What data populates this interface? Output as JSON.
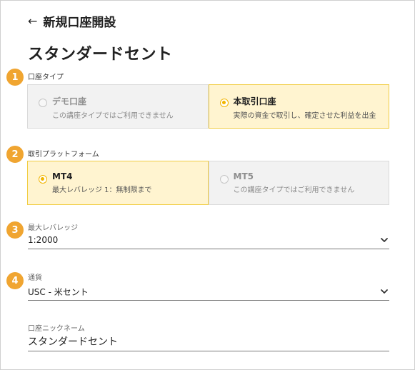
{
  "header": {
    "back_icon": "arrow-left-icon",
    "back_title": "新規口座開設"
  },
  "page_title": "スタンダードセント",
  "steps": [
    "1",
    "2",
    "3",
    "4"
  ],
  "account_type": {
    "label": "口座タイプ",
    "options": [
      {
        "title": "デモ口座",
        "description": "この講座タイプではご利用できません",
        "selected": false
      },
      {
        "title": "本取引口座",
        "description": "実際の資金で取引し、確定させた利益を出金",
        "selected": true
      }
    ]
  },
  "platform": {
    "label": "取引プラットフォーム",
    "options": [
      {
        "title": "MT4",
        "description": "最大レバレッジ 1：無制限まで",
        "selected": true
      },
      {
        "title": "MT5",
        "description": "この講座タイプではご利用できません",
        "selected": false
      }
    ]
  },
  "leverage": {
    "label": "最大レバレッジ",
    "value": "1:2000",
    "icon": "chevron-down-icon"
  },
  "currency": {
    "label": "通貨",
    "value": "USC - 米セント",
    "icon": "chevron-down-icon"
  },
  "nickname": {
    "label": "口座ニックネーム",
    "value": "スタンダードセント"
  },
  "colors": {
    "accent": "#f0a531",
    "selected_bg": "#fff4d0",
    "selected_border": "#f1cd43",
    "disabled_bg": "#f2f2f2"
  }
}
